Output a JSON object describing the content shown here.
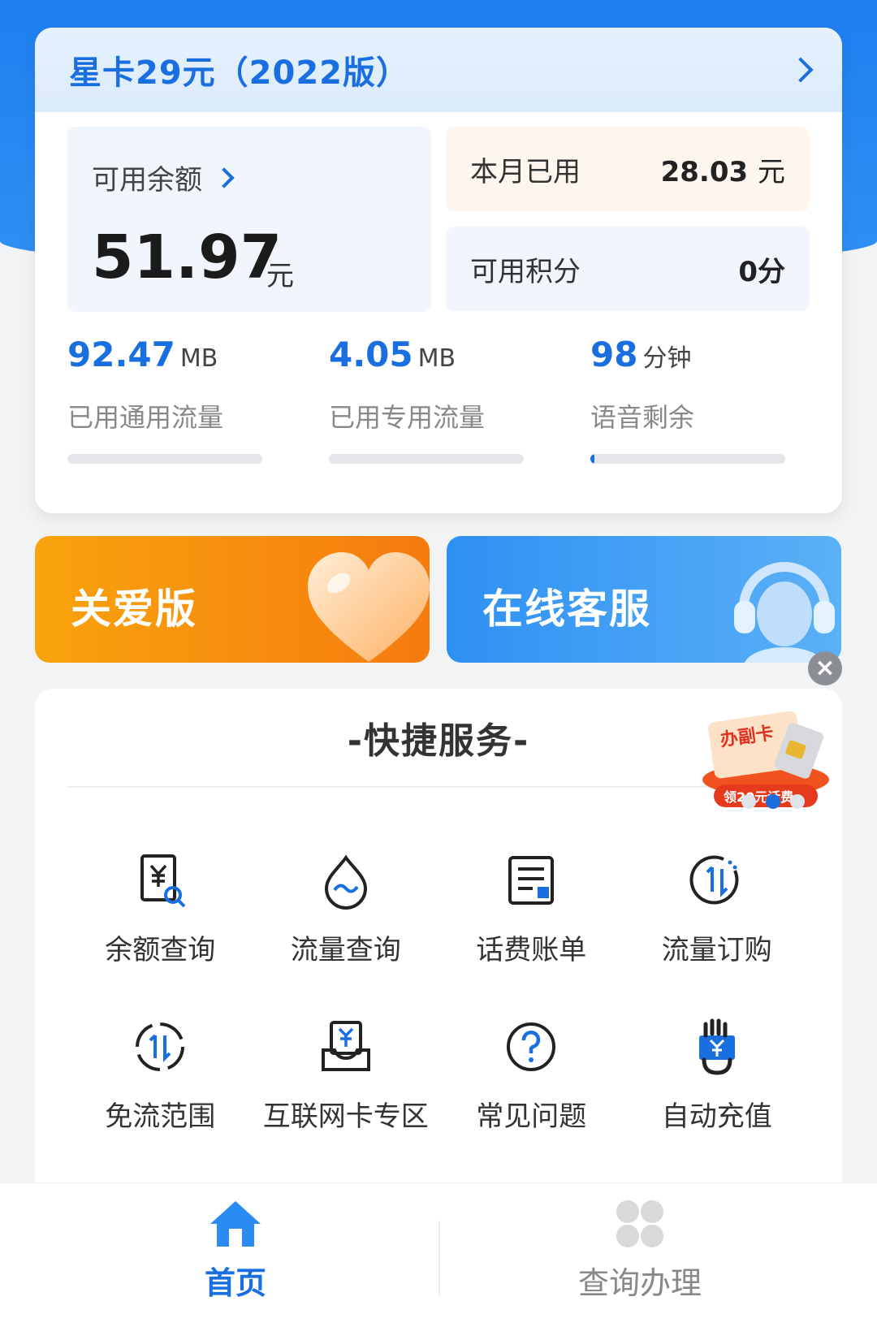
{
  "plan": {
    "title": "星卡29元（2022版）"
  },
  "balance": {
    "label": "可用余额",
    "value": "51.97",
    "unit": "元"
  },
  "monthly_used": {
    "label": "本月已用",
    "value": "28.03",
    "unit": "元"
  },
  "points": {
    "label": "可用积分",
    "value": "0分"
  },
  "stats": [
    {
      "value": "92.47",
      "unit": "MB",
      "label": "已用通用流量",
      "progress": 0
    },
    {
      "value": "4.05",
      "unit": "MB",
      "label": "已用专用流量",
      "progress": 0
    },
    {
      "value": "98",
      "unit": "分钟",
      "label": "语音剩余",
      "progress": 0.02
    }
  ],
  "banners": {
    "care": "关爱版",
    "service": "在线客服"
  },
  "services": {
    "title": "-快捷服务-",
    "promo": {
      "text": "办副卡",
      "sub": "领20元话费"
    },
    "items": [
      {
        "label": "余额查询",
        "icon": "balance-query-icon"
      },
      {
        "label": "流量查询",
        "icon": "data-query-icon"
      },
      {
        "label": "话费账单",
        "icon": "bill-icon"
      },
      {
        "label": "流量订购",
        "icon": "data-order-icon"
      },
      {
        "label": "免流范围",
        "icon": "free-data-icon"
      },
      {
        "label": "互联网卡专区",
        "icon": "internet-card-icon"
      },
      {
        "label": "常见问题",
        "icon": "faq-icon"
      },
      {
        "label": "自动充值",
        "icon": "auto-recharge-icon"
      }
    ]
  },
  "tabbar": {
    "home": "首页",
    "query": "查询办理"
  },
  "colors": {
    "accent": "#1a6fe0",
    "care_orange": "#f57b0f",
    "service_blue": "#2e90f2"
  }
}
